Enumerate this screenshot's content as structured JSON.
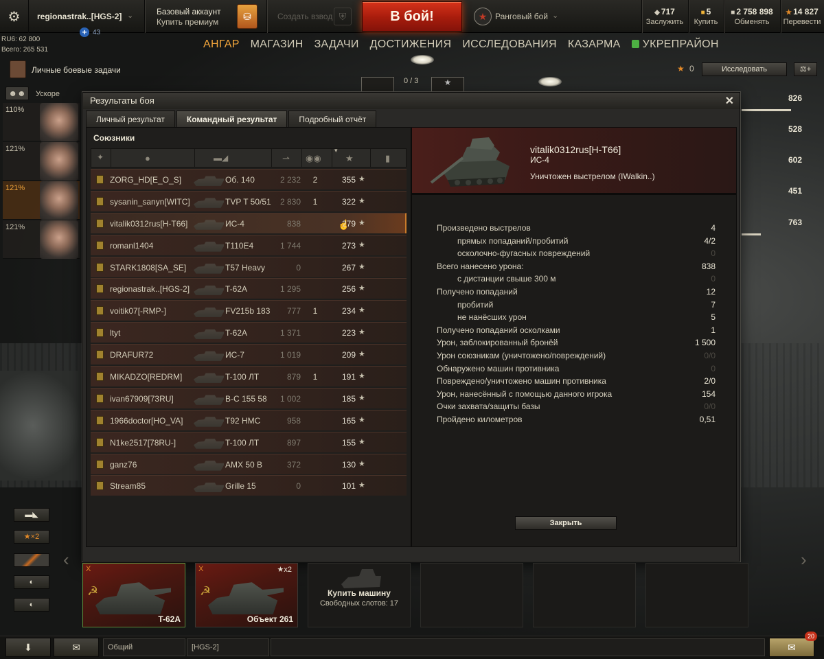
{
  "topbar": {
    "account_name": "regionastrak..[HGS-2]",
    "plus_count": "43",
    "premium_title": "Базовый аккаунт",
    "premium_buy": "Купить премиум",
    "platoon_label": "Создать взвод",
    "battle_label": "В бой!",
    "mode_label": "Ранговый бой",
    "currencies": [
      {
        "value": "717",
        "label": "Заслужить",
        "icon": "bond-icon",
        "color": "#d3cdbd"
      },
      {
        "value": "5",
        "label": "Купить",
        "icon": "gold-icon",
        "color": "#f0b43a"
      },
      {
        "value": "2 758 898",
        "label": "Обменять",
        "icon": "credits-icon",
        "color": "#d3cdbd"
      },
      {
        "value": "14 827",
        "label": "Перевести",
        "icon": "free-xp-icon",
        "color": "#e38a28"
      }
    ]
  },
  "stats_overlay": {
    "line1": "RU6: 62 800",
    "line2": "Всего: 265 531"
  },
  "nav": {
    "items": [
      "АНГАР",
      "МАГАЗИН",
      "ЗАДАЧИ",
      "ДОСТИЖЕНИЯ",
      "ИССЛЕДОВАНИЯ",
      "КАЗАРМА",
      "УКРЕПРАЙОН"
    ],
    "active": "АНГАР"
  },
  "missions": {
    "label": "Личные боевые задачи",
    "accel_label": "Ускоре"
  },
  "crew": [
    {
      "pct": "110%"
    },
    {
      "pct": "121%"
    },
    {
      "pct": "121%"
    },
    {
      "pct": "121%"
    }
  ],
  "counter": {
    "text": "0 / 3"
  },
  "research": {
    "count": "0",
    "button_label": "Исследовать"
  },
  "right_stats": [
    "826",
    "528",
    "602",
    "451",
    "763"
  ],
  "dialog": {
    "title": "Результаты боя",
    "tabs": [
      "Личный результат",
      "Командный результат",
      "Подробный отчёт"
    ],
    "active_tab": "Командный результат",
    "allies_label": "Союзники",
    "rows": [
      {
        "name": "ZORG_HD[E_O_S]",
        "vehicle": "Об. 140",
        "damage": "2 232",
        "kills": "2",
        "xp": "355"
      },
      {
        "name": "sysanin_sanyn[WITC]",
        "vehicle": "TVP T 50/51",
        "damage": "2 830",
        "kills": "1",
        "xp": "322"
      },
      {
        "name": "vitalik0312rus[H-T66]",
        "vehicle": "ИС-4",
        "damage": "838",
        "kills": "",
        "xp": "279"
      },
      {
        "name": "romanl1404",
        "vehicle": "T110E4",
        "damage": "1 744",
        "kills": "",
        "xp": "273"
      },
      {
        "name": "STARK1808[SA_SE]",
        "vehicle": "T57 Heavy",
        "damage": "0",
        "kills": "",
        "xp": "267"
      },
      {
        "name": "regionastrak..[HGS-2]",
        "vehicle": "T-62A",
        "damage": "1 295",
        "kills": "",
        "xp": "256"
      },
      {
        "name": "voitik07[-RMP-]",
        "vehicle": "FV215b 183",
        "damage": "777",
        "kills": "1",
        "xp": "234"
      },
      {
        "name": "ltyt",
        "vehicle": "T-62A",
        "damage": "1 371",
        "kills": "",
        "xp": "223"
      },
      {
        "name": "DRAFUR72",
        "vehicle": "ИС-7",
        "damage": "1 019",
        "kills": "",
        "xp": "209"
      },
      {
        "name": "MIKADZO[REDRM]",
        "vehicle": "T-100 ЛТ",
        "damage": "879",
        "kills": "1",
        "xp": "191"
      },
      {
        "name": "ivan67909[73RU]",
        "vehicle": "B-C 155 58",
        "damage": "1 002",
        "kills": "",
        "xp": "185"
      },
      {
        "name": "1966doctor[HO_VA]",
        "vehicle": "T92 HMC",
        "damage": "958",
        "kills": "",
        "xp": "165"
      },
      {
        "name": "N1ke2517[78RU-]",
        "vehicle": "T-100 ЛТ",
        "damage": "897",
        "kills": "",
        "xp": "155"
      },
      {
        "name": "ganz76",
        "vehicle": "AMX 50 B",
        "damage": "372",
        "kills": "",
        "xp": "130"
      },
      {
        "name": "Stream85",
        "vehicle": "Grille 15",
        "damage": "0",
        "kills": "",
        "xp": "101"
      }
    ],
    "selected_row": 2,
    "detail": {
      "player": "vitalik0312rus[H-T66]",
      "vehicle": "ИС-4",
      "status": "Уничтожен выстрелом (IWalkin..)",
      "stats": [
        {
          "label": "Произведено выстрелов",
          "value": "4",
          "sub": false,
          "dim": false
        },
        {
          "label": "прямых попаданий/пробитий",
          "value": "4/2",
          "sub": true,
          "dim": false
        },
        {
          "label": "осколочно-фугасных повреждений",
          "value": "0",
          "sub": true,
          "dim": true
        },
        {
          "label": "Всего нанесено урона:",
          "value": "838",
          "sub": false,
          "dim": false
        },
        {
          "label": "с дистанции свыше 300 м",
          "value": "0",
          "sub": true,
          "dim": true
        },
        {
          "label": "Получено попаданий",
          "value": "12",
          "sub": false,
          "dim": false
        },
        {
          "label": "пробитий",
          "value": "7",
          "sub": true,
          "dim": false
        },
        {
          "label": "не нанёсших урон",
          "value": "5",
          "sub": true,
          "dim": false
        },
        {
          "label": "Получено попаданий осколками",
          "value": "1",
          "sub": false,
          "dim": false
        },
        {
          "label": "Урон, заблокированный бронёй",
          "value": "1 500",
          "sub": false,
          "dim": false
        },
        {
          "label": "Урон союзникам (уничтожено/повреждений)",
          "value": "0/0",
          "sub": false,
          "dim": true
        },
        {
          "label": "Обнаружено машин противника",
          "value": "0",
          "sub": false,
          "dim": true
        },
        {
          "label": "Повреждено/уничтожено машин противника",
          "value": "2/0",
          "sub": false,
          "dim": false,
          "partial": true
        },
        {
          "label": "Урон, нанесённый с помощью данного игрока",
          "value": "154",
          "sub": false,
          "dim": false
        },
        {
          "label": "Очки захвата/защиты базы",
          "value": "0/0",
          "sub": false,
          "dim": true
        },
        {
          "label": "Пройдено километров",
          "value": "0,51",
          "sub": false,
          "dim": false
        }
      ],
      "close_label": "Закрыть"
    }
  },
  "carousel": {
    "filters": [
      "tank-filter-icon",
      "x2-filter",
      "premium-filter-icon",
      "nation-filter-icon",
      "nation-filter-icon-2"
    ],
    "x2_label": "★×2",
    "vehicles": [
      {
        "name": "T-62A",
        "tier": "X",
        "x2": ""
      },
      {
        "name": "Объект 261",
        "tier": "X",
        "x2": "★x2"
      }
    ],
    "buy_title": "Купить машину",
    "buy_sub": "Свободных слотов: 17"
  },
  "bottombar": {
    "channels": [
      "Общий",
      "[HGS-2]"
    ],
    "notif_count": "20"
  }
}
